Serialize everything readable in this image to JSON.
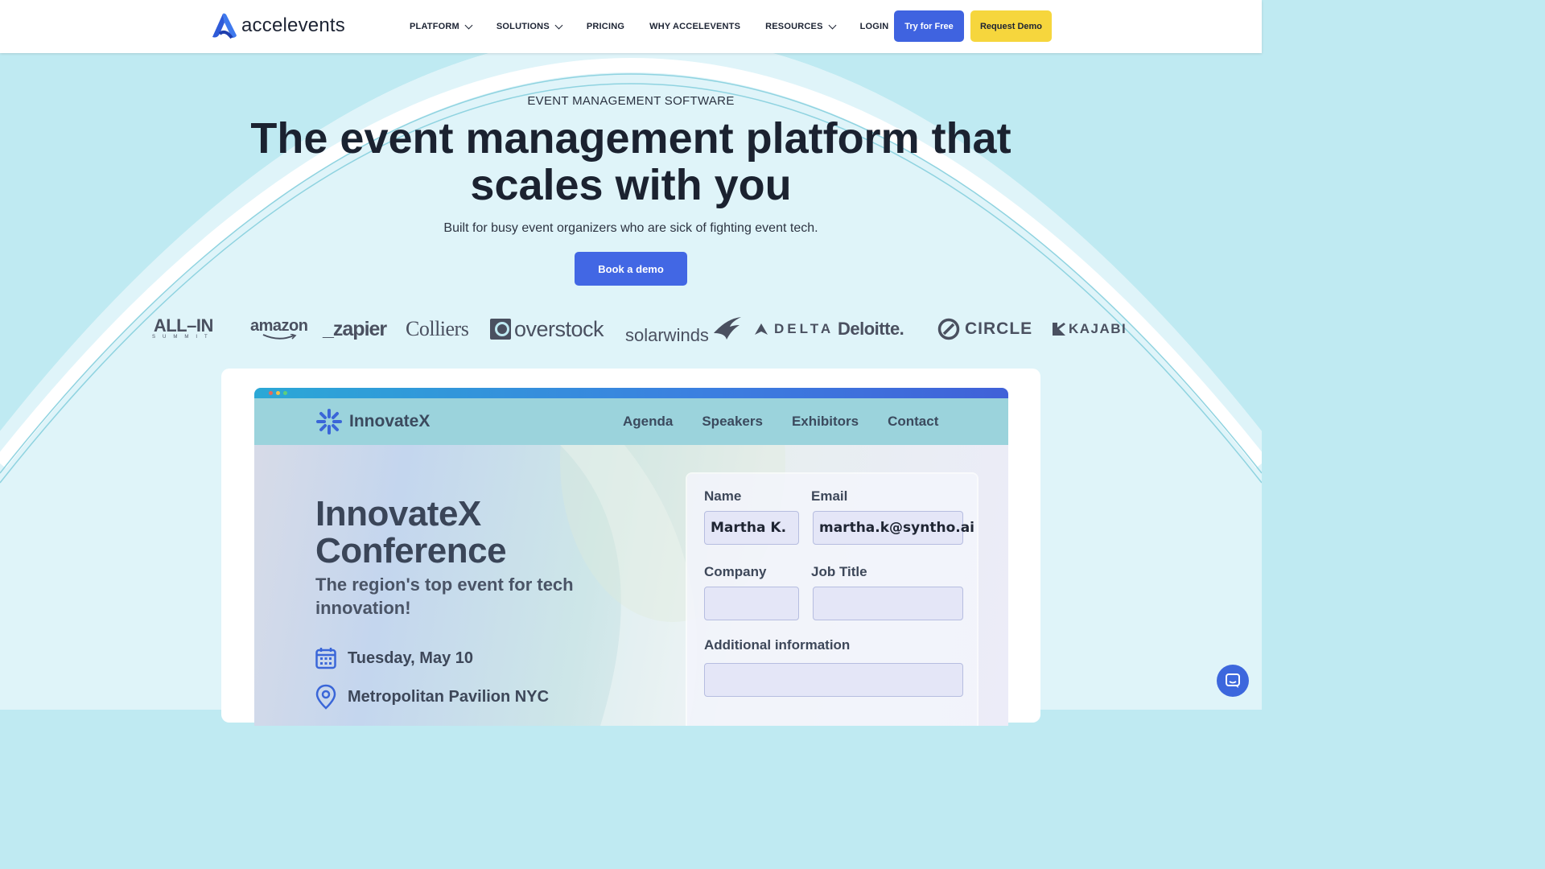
{
  "header": {
    "logo_text": "accelevents",
    "nav": [
      {
        "label": "PLATFORM",
        "dropdown": true
      },
      {
        "label": "SOLUTIONS",
        "dropdown": true
      },
      {
        "label": "PRICING",
        "dropdown": false
      },
      {
        "label": "WHY ACCELEVENTS",
        "dropdown": false
      },
      {
        "label": "RESOURCES",
        "dropdown": true
      },
      {
        "label": "LOGIN",
        "dropdown": false
      }
    ],
    "try_label": "Try for Free",
    "demo_label": "Request Demo"
  },
  "hero": {
    "eyebrow": "EVENT MANAGEMENT SOFTWARE",
    "headline_line1": "The event management platform that",
    "headline_line2": "scales with you",
    "subtitle": "Built for busy event organizers who are sick of fighting event tech.",
    "cta_label": "Book a demo"
  },
  "customer_logos": {
    "allin": "ALL–IN",
    "allin_sub": "SUMMIT",
    "amazon": "amazon",
    "zapier": "_zapier",
    "colliers": "Colliers",
    "overstock": "overstock",
    "solarwinds": "solarwinds",
    "delta": "DELTA",
    "deloitte": "Deloitte.",
    "circle": "CIRCLE",
    "kajabi": "KAJABI"
  },
  "preview": {
    "site_name": "InnovateX",
    "site_nav": [
      "Agenda",
      "Speakers",
      "Exhibitors",
      "Contact"
    ],
    "conference_title_1": "InnovateX",
    "conference_title_2": "Conference",
    "conference_subtitle": "The region's top event for tech innovation!",
    "date": "Tuesday, May 10",
    "venue": "Metropolitan Pavilion NYC",
    "form": {
      "name_label": "Name",
      "name_value": "Martha K.",
      "email_label": "Email",
      "email_value": "martha.k@syntho.ai",
      "company_label": "Company",
      "company_value": "",
      "job_title_label": "Job Title",
      "job_title_value": "",
      "additional_label": "Additional information",
      "additional_value": ""
    }
  },
  "colors": {
    "primary_blue": "#3f63e0",
    "accent_yellow": "#f6d63d",
    "hero_bg": "#bfeaf2",
    "text_dark": "#1b2230"
  },
  "icons": [
    "accelevents-logo-icon",
    "chevron-down-icon",
    "innovatex-logo-icon",
    "calendar-icon",
    "location-pin-icon",
    "chat-icon"
  ]
}
